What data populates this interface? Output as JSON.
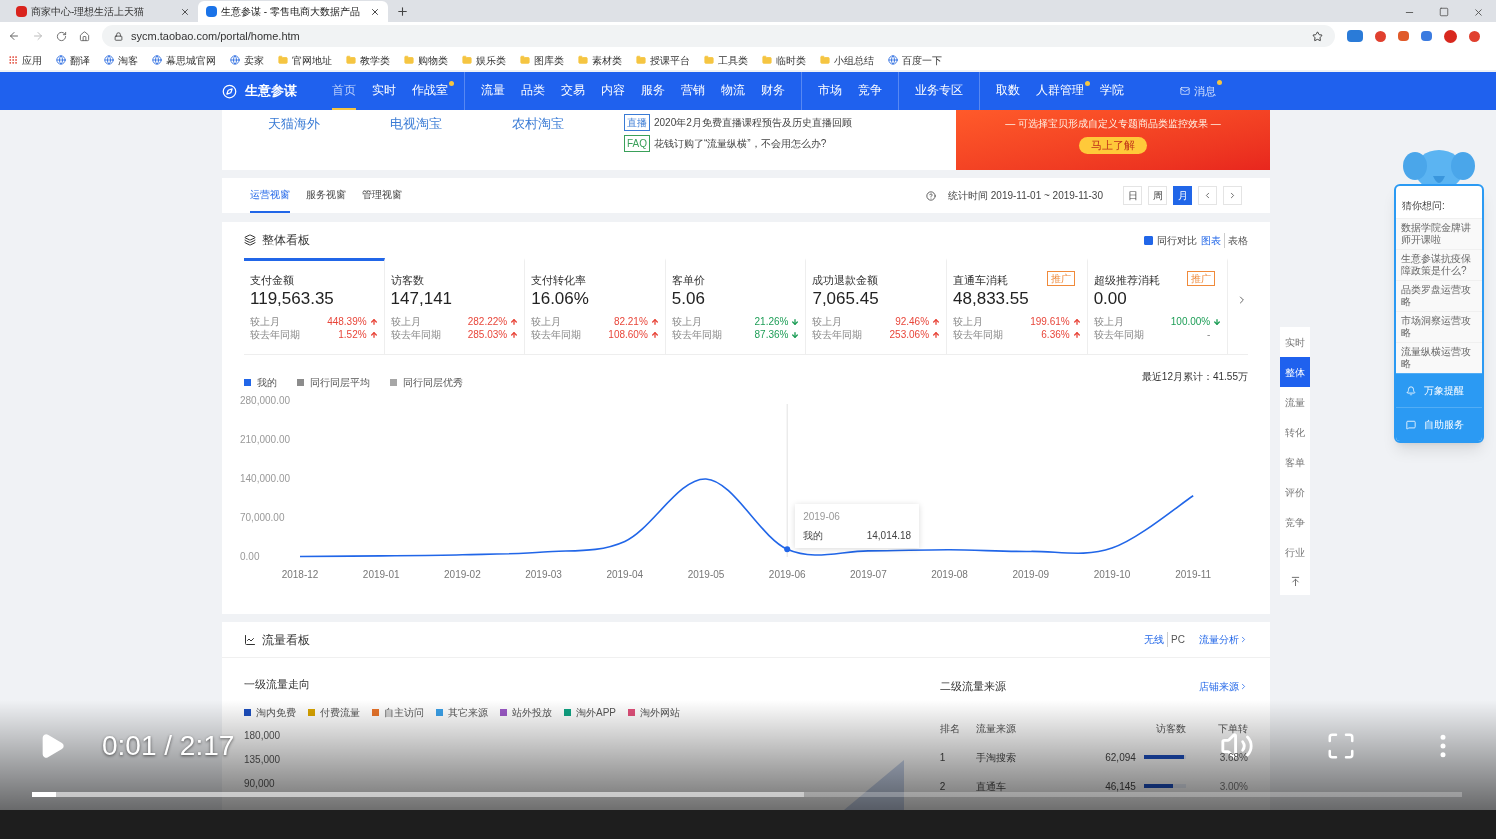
{
  "browser": {
    "tabs": [
      {
        "title": "商家中心-理想生活上天猫",
        "selected": false
      },
      {
        "title": "生意参谋 - 零售电商大数据产品",
        "selected": true
      }
    ],
    "url": "sycm.taobao.com/portal/home.htm",
    "bookmarks": [
      {
        "label": "应用",
        "kind": "apps"
      },
      {
        "label": "翻译",
        "kind": "site"
      },
      {
        "label": "淘客",
        "kind": "site"
      },
      {
        "label": "幕思城官网",
        "kind": "site"
      },
      {
        "label": "卖家",
        "kind": "site"
      },
      {
        "label": "官网地址",
        "kind": "folder"
      },
      {
        "label": "教学类",
        "kind": "folder"
      },
      {
        "label": "购物类",
        "kind": "folder"
      },
      {
        "label": "娱乐类",
        "kind": "folder"
      },
      {
        "label": "图库类",
        "kind": "folder"
      },
      {
        "label": "素材类",
        "kind": "folder"
      },
      {
        "label": "授课平台",
        "kind": "folder"
      },
      {
        "label": "工具类",
        "kind": "folder"
      },
      {
        "label": "临时类",
        "kind": "folder"
      },
      {
        "label": "小组总结",
        "kind": "folder"
      },
      {
        "label": "百度一下",
        "kind": "site"
      }
    ]
  },
  "nav": {
    "logo": "生意参谋",
    "groups": [
      [
        {
          "label": "首页",
          "selected": true,
          "dot": false
        },
        {
          "label": "实时",
          "selected": false,
          "dot": false
        },
        {
          "label": "作战室",
          "selected": false,
          "dot": true
        }
      ],
      [
        {
          "label": "流量",
          "selected": false,
          "dot": false
        },
        {
          "label": "品类",
          "selected": false,
          "dot": false
        },
        {
          "label": "交易",
          "selected": false,
          "dot": false
        },
        {
          "label": "内容",
          "selected": false,
          "dot": false
        },
        {
          "label": "服务",
          "selected": false,
          "dot": false
        },
        {
          "label": "营销",
          "selected": false,
          "dot": false
        },
        {
          "label": "物流",
          "selected": false,
          "dot": false
        },
        {
          "label": "财务",
          "selected": false,
          "dot": false
        }
      ],
      [
        {
          "label": "市场",
          "selected": false,
          "dot": false
        },
        {
          "label": "竞争",
          "selected": false,
          "dot": false
        }
      ],
      [
        {
          "label": "业务专区",
          "selected": false,
          "dot": false
        }
      ],
      [
        {
          "label": "取数",
          "selected": false,
          "dot": false
        },
        {
          "label": "人群管理",
          "selected": false,
          "dot": true
        },
        {
          "label": "学院",
          "selected": false,
          "dot": false
        }
      ]
    ],
    "messages": {
      "label": "消息",
      "dot": true
    }
  },
  "banner": {
    "links": [
      "天猫海外",
      "电视淘宝",
      "农村淘宝"
    ],
    "news": [
      {
        "tag": "直播",
        "kind": "live",
        "text": "2020年2月免费直播课程预告及历史直播回顾"
      },
      {
        "tag": "FAQ",
        "kind": "faq",
        "text": "花钱订购了“流量纵横”，不会用怎么办?"
      }
    ],
    "ad": {
      "text": "— 可选择宝贝形成自定义专题商品类监控效果 —",
      "button": "马上了解"
    }
  },
  "views": {
    "tabs": [
      {
        "label": "运营视窗",
        "selected": true
      },
      {
        "label": "服务视窗",
        "selected": false
      },
      {
        "label": "管理视窗",
        "selected": false
      }
    ],
    "period": "统计时间 2019-11-01 ~ 2019-11-30",
    "ranges": [
      {
        "label": "日",
        "selected": false
      },
      {
        "label": "周",
        "selected": false
      },
      {
        "label": "月",
        "selected": true
      }
    ]
  },
  "overview": {
    "title": "整体看板",
    "compare": {
      "label": "同行对比",
      "checked": true
    },
    "modes": [
      {
        "label": "图表",
        "selected": true
      },
      {
        "label": "表格",
        "selected": false
      }
    ],
    "cards": [
      {
        "title": "支付金额",
        "value": "119,563.35",
        "selected": true,
        "rows": [
          {
            "label": "较上月",
            "value": "448.39%",
            "kind": "up"
          },
          {
            "label": "较去年同期",
            "value": "1.52%",
            "kind": "up"
          }
        ]
      },
      {
        "title": "访客数",
        "value": "147,141",
        "selected": false,
        "rows": [
          {
            "label": "较上月",
            "value": "282.22%",
            "kind": "up"
          },
          {
            "label": "较去年同期",
            "value": "285.03%",
            "kind": "up"
          }
        ]
      },
      {
        "title": "支付转化率",
        "value": "16.06%",
        "selected": false,
        "rows": [
          {
            "label": "较上月",
            "value": "82.21%",
            "kind": "up"
          },
          {
            "label": "较去年同期",
            "value": "108.60%",
            "kind": "up"
          }
        ]
      },
      {
        "title": "客单价",
        "value": "5.06",
        "selected": false,
        "rows": [
          {
            "label": "较上月",
            "value": "21.26%",
            "kind": "down"
          },
          {
            "label": "较去年同期",
            "value": "87.36%",
            "kind": "down"
          }
        ]
      },
      {
        "title": "成功退款金额",
        "value": "7,065.45",
        "selected": false,
        "rows": [
          {
            "label": "较上月",
            "value": "92.46%",
            "kind": "up"
          },
          {
            "label": "较去年同期",
            "value": "253.06%",
            "kind": "up"
          }
        ]
      },
      {
        "title": "直通车消耗",
        "value": "48,833.55",
        "badge": "推广",
        "selected": false,
        "rows": [
          {
            "label": "较上月",
            "value": "199.61%",
            "kind": "up"
          },
          {
            "label": "较去年同期",
            "value": "6.36%",
            "kind": "up"
          }
        ]
      },
      {
        "title": "超级推荐消耗",
        "value": "0.00",
        "badge": "推广",
        "selected": false,
        "rows": [
          {
            "label": "较上月",
            "value": "100.00%",
            "kind": "down"
          },
          {
            "label": "较去年同期",
            "value": "-",
            "kind": "flat"
          }
        ]
      }
    ],
    "legend": [
      {
        "label": "同行同层平均",
        "color": "#8c8c8c"
      },
      {
        "label": "同行同层优秀",
        "color": "#a6a6a6"
      }
    ],
    "total": "最近12月累计：41.55万",
    "chart_data": {
      "type": "line",
      "categories": [
        "2018-12",
        "2019-01",
        "2019-02",
        "2019-03",
        "2019-04",
        "2019-05",
        "2019-06",
        "2019-07",
        "2019-08",
        "2019-09",
        "2019-10",
        "2019-11"
      ],
      "series": [
        {
          "name": "我的",
          "color": "#2166e8",
          "values": [
            1000,
            2000,
            4000,
            9000,
            28000,
            140000,
            14000,
            11000,
            13000,
            10000,
            16000,
            110000
          ]
        }
      ],
      "ylim": [
        0,
        280000
      ],
      "yticks": [
        {
          "value": 0,
          "label": "0.00"
        },
        {
          "value": 70000,
          "label": "70,000.00"
        },
        {
          "value": 140000,
          "label": "140,000.00"
        },
        {
          "value": 210000,
          "label": "210,000.00"
        },
        {
          "value": 280000,
          "label": "280,000.00"
        }
      ]
    },
    "tooltip": {
      "title": "2019-06",
      "series": "我的",
      "value": "14,014.18"
    }
  },
  "traffic": {
    "title": "流量看板",
    "devices": [
      "无线",
      "PC"
    ],
    "analysis_link": "流量分析",
    "left_title": "一级流量走向",
    "legend": [
      {
        "label": "淘内免费",
        "color": "#1d4fbf"
      },
      {
        "label": "付费流量",
        "color": "#d9a400"
      },
      {
        "label": "自主访问",
        "color": "#e8742a"
      },
      {
        "label": "其它来源",
        "color": "#3aa0e8"
      },
      {
        "label": "站外投放",
        "color": "#9b59c6"
      },
      {
        "label": "淘外APP",
        "color": "#10a383"
      },
      {
        "label": "淘外网站",
        "color": "#e0507a"
      }
    ],
    "axis_labels": [
      "180,000",
      "135,000",
      "90,000"
    ],
    "right_title": "二级流量来源",
    "source_link": "店铺来源",
    "columns": [
      "排名",
      "流量来源",
      "访客数",
      "下单转"
    ],
    "rows": [
      {
        "rank": "1",
        "source": "手淘搜索",
        "visitors": "62,094",
        "level": 0.95,
        "rate": "3.68%"
      },
      {
        "rank": "2",
        "source": "直通车",
        "visitors": "46,145",
        "level": 0.7,
        "rate": "3.00%"
      }
    ]
  },
  "side_nav": [
    {
      "label": "实时",
      "selected": false
    },
    {
      "label": "整体",
      "selected": true
    },
    {
      "label": "流量",
      "selected": false
    },
    {
      "label": "转化",
      "selected": false
    },
    {
      "label": "客单",
      "selected": false
    },
    {
      "label": "评价",
      "selected": false
    },
    {
      "label": "竞争",
      "selected": false
    },
    {
      "label": "行业",
      "selected": false
    }
  ],
  "help_panel": {
    "title": "猜你想问:",
    "questions": [
      "数据学院金牌讲师开课啦",
      "生意参谋抗疫保障政策是什么?",
      "品类罗盘运营攻略",
      "市场洞察运营攻略",
      "流量纵横运营攻略"
    ],
    "actions": [
      {
        "label": "万象提醒",
        "kind": "bell"
      },
      {
        "label": "自助服务",
        "kind": "chat"
      }
    ]
  },
  "player": {
    "time": "0:01 / 2:17",
    "playing": false,
    "level": 0.017
  }
}
